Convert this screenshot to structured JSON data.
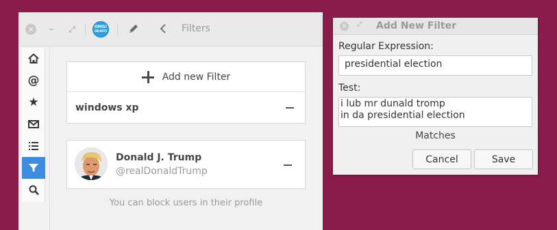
{
  "main_window": {
    "title": "Filters",
    "avatar_text_top": "OMG!",
    "avatar_text_bottom": "UBUNTU",
    "sidebar": [
      {
        "icon": "home-icon",
        "active": false
      },
      {
        "icon": "at-sign-icon",
        "active": false
      },
      {
        "icon": "star-icon",
        "active": false
      },
      {
        "icon": "envelope-icon",
        "active": false
      },
      {
        "icon": "list-icon",
        "active": false
      },
      {
        "icon": "filter-icon",
        "active": true
      },
      {
        "icon": "search-icon",
        "active": false
      }
    ],
    "add_filter_label": "Add new Filter",
    "filters": [
      "windows xp"
    ],
    "blocked_user": {
      "name": "Donald J. Trump",
      "handle": "@realDonaldTrump"
    },
    "hint": "You can block users in their profile"
  },
  "dialog": {
    "title": "Add New Filter",
    "regex_label": "Regular Expression:",
    "regex_value": "presidential election",
    "test_label": "Test:",
    "test_lines": [
      "i lub mr dunald tromp",
      "in da presidential election"
    ],
    "status": "Matches",
    "cancel_label": "Cancel",
    "save_label": "Save"
  },
  "colors": {
    "desktop": "#8a1c4c",
    "accent": "#3d8ee0"
  }
}
